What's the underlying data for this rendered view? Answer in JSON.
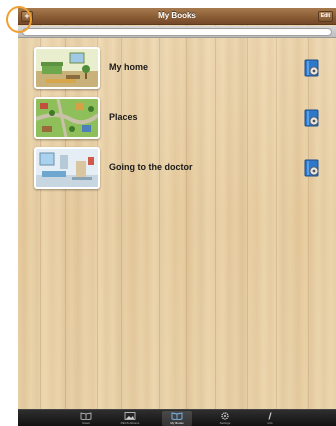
{
  "navbar": {
    "title": "My Books",
    "add_label": "+",
    "edit_label": "Edit"
  },
  "books": [
    {
      "title": "My home"
    },
    {
      "title": "Places"
    },
    {
      "title": "Going to the doctor"
    }
  ],
  "tabbar": {
    "tabs": [
      {
        "label": "Read",
        "icon": "book-open-icon"
      },
      {
        "label": "PECS Albums",
        "icon": "picture-icon"
      },
      {
        "label": "My Books",
        "icon": "books-icon",
        "selected": true
      },
      {
        "label": "Settings",
        "icon": "gear-icon"
      },
      {
        "label": "Info",
        "icon": "info-icon"
      }
    ]
  },
  "colors": {
    "wood": "#e8cfa6",
    "navbar": "#8a5d35",
    "highlight": "#f0a030",
    "tabbar": "#121212"
  }
}
